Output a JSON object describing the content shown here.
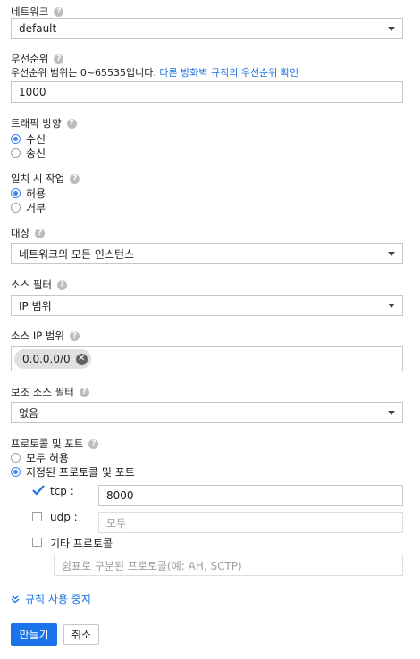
{
  "network": {
    "label": "네트워크",
    "value": "default"
  },
  "priority": {
    "label": "우선순위",
    "hint": "우선순위 범위는 0~65535입니다.",
    "hint_link": "다른 방화벽 규칙의 우선순위 확인",
    "value": "1000"
  },
  "direction": {
    "label": "트래픽 방향",
    "options": [
      "수신",
      "송신"
    ],
    "selected": "수신"
  },
  "action": {
    "label": "일치 시 작업",
    "options": [
      "허용",
      "거부"
    ],
    "selected": "허용"
  },
  "target": {
    "label": "대상",
    "value": "네트워크의 모든 인스턴스"
  },
  "source_filter": {
    "label": "소스 필터",
    "value": "IP 범위"
  },
  "source_ip": {
    "label": "소스 IP 범위",
    "chip": "0.0.0.0/0"
  },
  "secondary_filter": {
    "label": "보조 소스 필터",
    "value": "없음"
  },
  "protocols": {
    "label": "프로토콜 및 포트",
    "options": [
      "모두 허용",
      "지정된 프로토콜 및 포트"
    ],
    "selected": "지정된 프로토콜 및 포트",
    "tcp": {
      "label": "tcp :",
      "checked": true,
      "value": "8000"
    },
    "udp": {
      "label": "udp :",
      "checked": false,
      "placeholder": "모두"
    },
    "other": {
      "label": "기타 프로토콜",
      "checked": false,
      "placeholder": "쉼표로 구분된 프로토콜(예: AH, SCTP)"
    }
  },
  "toggle_link": "규칙 사용 중지",
  "buttons": {
    "create": "만들기",
    "cancel": "취소"
  },
  "colors": {
    "accent": "#1a73e8",
    "radio": "#4285f4"
  }
}
